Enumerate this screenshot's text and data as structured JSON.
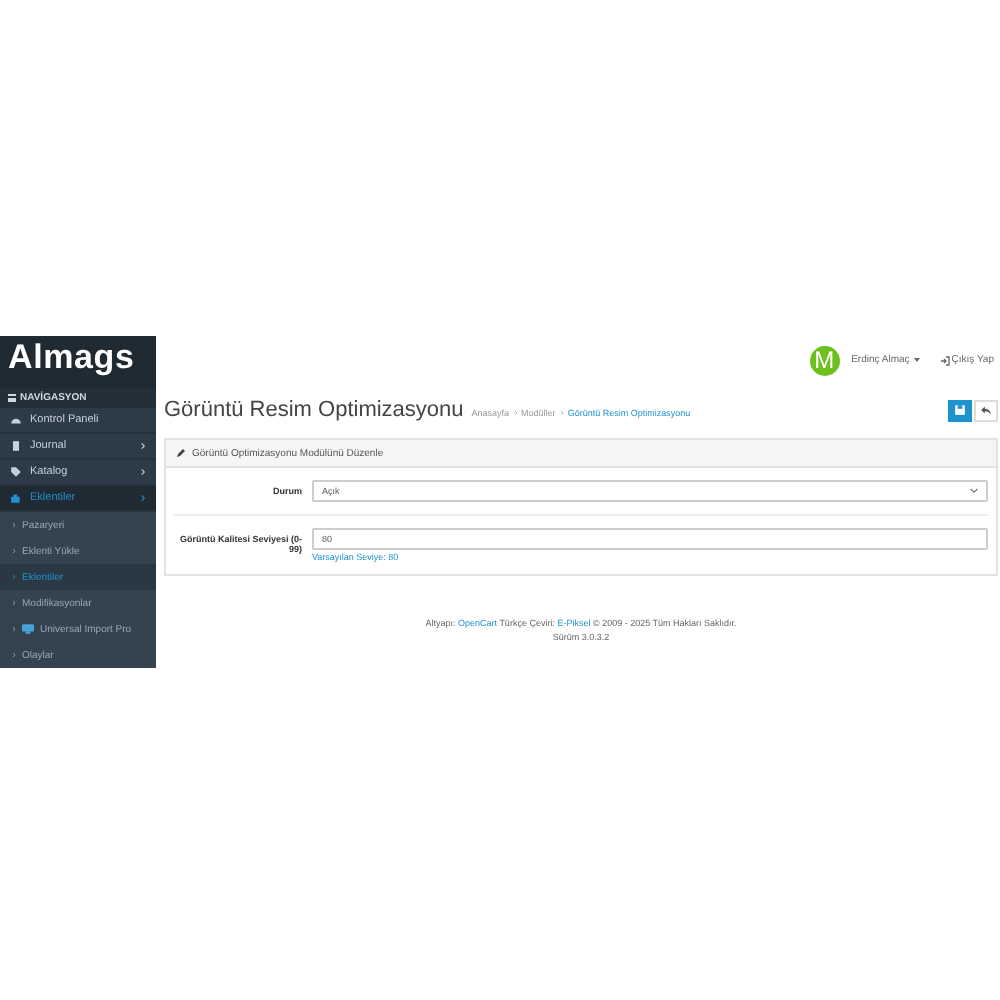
{
  "logo": "Almags",
  "nav_heading": "NAVİGASYON",
  "sidebar": {
    "items": [
      {
        "label": "Kontrol Paneli",
        "expandable": false,
        "selected": false
      },
      {
        "label": "Journal",
        "expandable": true,
        "selected": false
      },
      {
        "label": "Katalog",
        "expandable": true,
        "selected": false
      },
      {
        "label": "Eklentiler",
        "expandable": true,
        "selected": true,
        "children": [
          {
            "label": "Pazaryeri",
            "selected": false
          },
          {
            "label": "Eklenti Yükle",
            "selected": false
          },
          {
            "label": "Eklentiler",
            "selected": true
          },
          {
            "label": "Modifikasyonlar",
            "selected": false
          },
          {
            "label": "Universal Import Pro",
            "selected": false
          },
          {
            "label": "Olaylar",
            "selected": false
          }
        ]
      }
    ]
  },
  "header": {
    "avatar_letter": "M",
    "user": "Erdinç Almaç",
    "logout": "Çıkış Yap"
  },
  "page": {
    "title": "Görüntü Resim Optimizasyonu",
    "breadcrumb": [
      {
        "label": "Anasayfa",
        "selected": false
      },
      {
        "label": "Modüller",
        "selected": false
      },
      {
        "label": "Görüntü Resim Optimizasyonu",
        "selected": true
      }
    ]
  },
  "panel": {
    "heading": "Görüntü Optimizasyonu Modülünü Düzenle",
    "fields": [
      {
        "kind": "select",
        "label": "Durum",
        "value": "Açık"
      },
      {
        "kind": "input",
        "label": "Görüntü Kalitesi Seviyesi (0-99)",
        "value": "80",
        "help": "Varsayılan Seviye: 80"
      }
    ]
  },
  "footer": {
    "parts": [
      {
        "text": "Altyapı:",
        "kind": "text"
      },
      {
        "text": "OpenCart",
        "kind": "link"
      },
      {
        "text": "Türkçe Çeviri:",
        "kind": "text"
      },
      {
        "text": "E-Piksel",
        "kind": "link"
      },
      {
        "text": "© 2009 - 2025 Tüm Hakları Saklıdır.",
        "kind": "text"
      }
    ],
    "version": "Sürüm 3.0.3.2"
  }
}
